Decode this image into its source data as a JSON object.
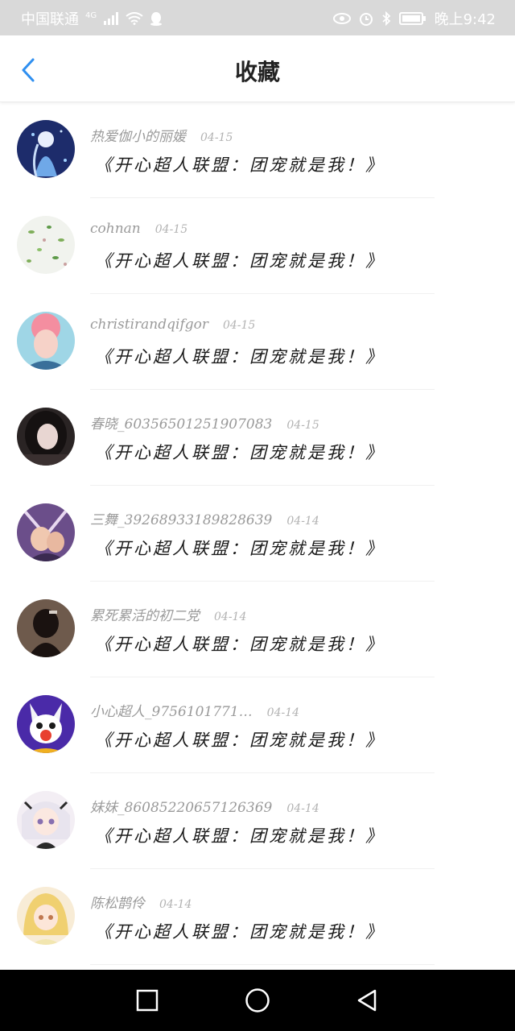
{
  "status_bar": {
    "carrier": "中国联通",
    "network": "4G",
    "time": "晚上9:42"
  },
  "header": {
    "title": "收藏"
  },
  "items": [
    {
      "username": "热爱伽小的丽媛",
      "date": "04-15",
      "content": "《开心超人联盟：团宠就是我！》",
      "avatar": "avatar-1"
    },
    {
      "username": "cohnan",
      "date": "04-15",
      "content": "《开心超人联盟：团宠就是我！》",
      "avatar": "avatar-2"
    },
    {
      "username": "christirandqifgor",
      "date": "04-15",
      "content": "《开心超人联盟：团宠就是我！》",
      "avatar": "avatar-3"
    },
    {
      "username": "春晓_60356501251907083",
      "date": "04-15",
      "content": "《开心超人联盟：团宠就是我！》",
      "avatar": "avatar-4"
    },
    {
      "username": "三舞_39268933189828639",
      "date": "04-14",
      "content": "《开心超人联盟：团宠就是我！》",
      "avatar": "avatar-5"
    },
    {
      "username": "累死累活的初二党",
      "date": "04-14",
      "content": "《开心超人联盟：团宠就是我！》",
      "avatar": "avatar-6"
    },
    {
      "username": "小心超人_9756101771…",
      "date": "04-14",
      "content": "《开心超人联盟：团宠就是我！》",
      "avatar": "avatar-7"
    },
    {
      "username": "妹妹_86085220657126369",
      "date": "04-14",
      "content": "《开心超人联盟：团宠就是我！》",
      "avatar": "avatar-8"
    },
    {
      "username": "陈松鹊伶",
      "date": "04-14",
      "content": "《开心超人联盟：团宠就是我！》",
      "avatar": "avatar-9"
    }
  ],
  "colors": {
    "accent": "#2f8ff0",
    "status_bar_bg": "#d9d9d9",
    "nav_bar_bg": "#000000"
  },
  "icons": {
    "back": "chevron-left-icon",
    "nav_recent": "square-icon",
    "nav_home": "circle-icon",
    "nav_back": "triangle-back-icon"
  }
}
